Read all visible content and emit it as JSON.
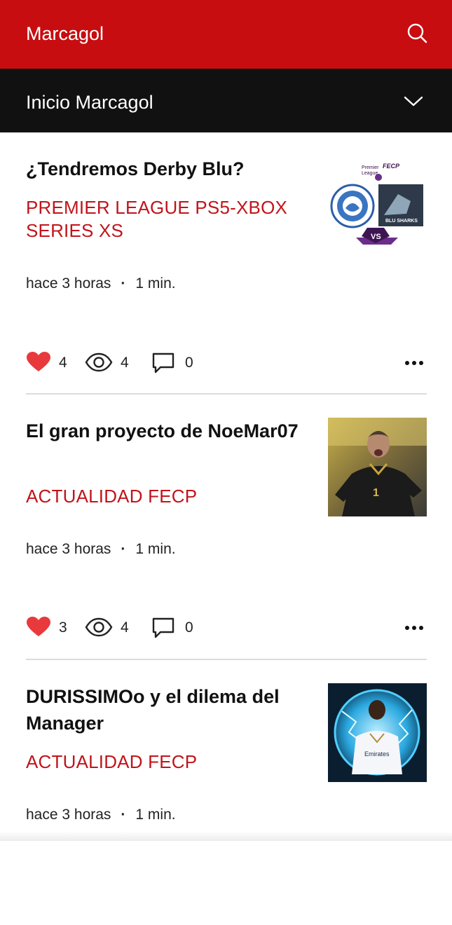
{
  "header": {
    "app_title": "Marcagol",
    "search_icon": "search-icon"
  },
  "subheader": {
    "label": "Inicio Marcagol",
    "dropdown_icon": "chevron-down-icon"
  },
  "colors": {
    "brand_red": "#c70d10",
    "category_red": "#c1141b",
    "heart": "#e8393d"
  },
  "posts": [
    {
      "title": "¿Tendremos Derby Blu?",
      "category": "PREMIER LEAGUE PS5-XBOX SERIES XS",
      "time": "hace 3 horas",
      "read_time": "1 min.",
      "likes": "4",
      "views": "4",
      "comments": "0",
      "thumb_logo_text": "Premier League FECP",
      "thumb_vs": "VS"
    },
    {
      "title": "El gran proyecto de NoeMar07",
      "category": "ACTUALIDAD FECP",
      "time": "hace 3 horas",
      "read_time": "1 min.",
      "likes": "3",
      "views": "4",
      "comments": "0"
    },
    {
      "title": "DURISSIMOo y el dilema del Manager",
      "category": "ACTUALIDAD FECP",
      "time": "hace 3 horas",
      "read_time": "1 min."
    }
  ],
  "separator": "·"
}
